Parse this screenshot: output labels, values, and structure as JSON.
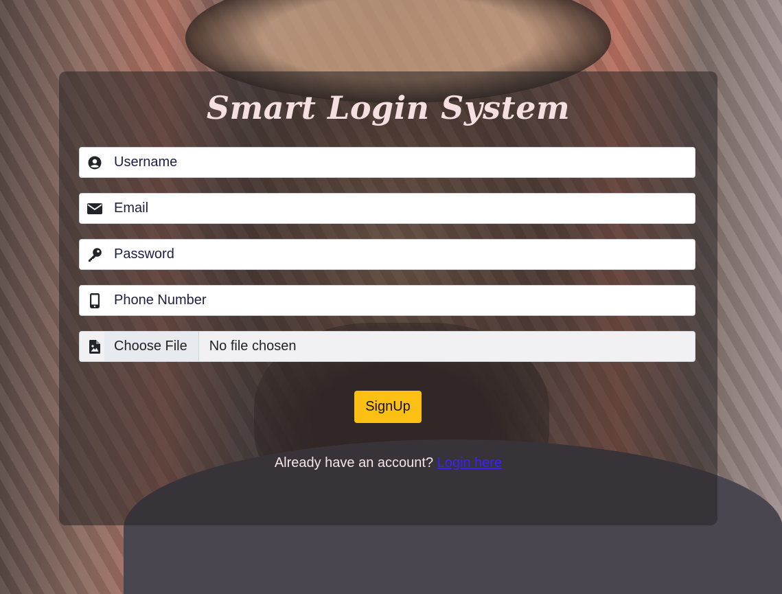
{
  "title": "Smart Login System",
  "fields": {
    "username": {
      "placeholder": "Username",
      "icon": "user-circle-icon"
    },
    "email": {
      "placeholder": "Email",
      "icon": "envelope-icon"
    },
    "password": {
      "placeholder": "Password",
      "icon": "key-icon"
    },
    "phone": {
      "placeholder": "Phone Number",
      "icon": "mobile-phone-icon"
    },
    "file": {
      "icon": "file-image-icon",
      "button_label": "Choose File",
      "status": "No file chosen"
    }
  },
  "signup_button": {
    "label": "SignUp",
    "color": "#fbc013"
  },
  "footer": {
    "prompt": "Already have an account?",
    "link_label": "Login here"
  },
  "colors": {
    "title": "#f6dfe1",
    "link": "#3b21ff"
  }
}
